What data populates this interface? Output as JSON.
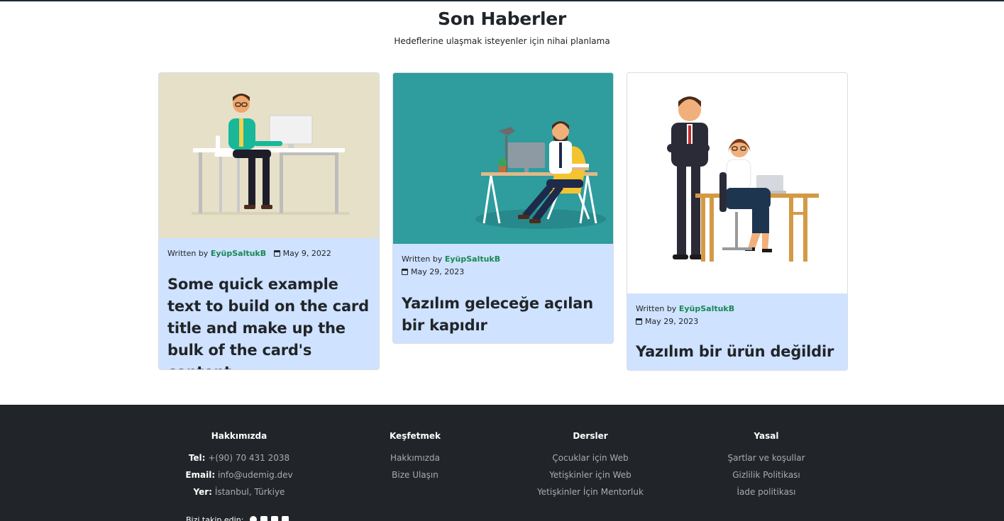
{
  "section": {
    "title": "Son Haberler",
    "subtitle": "Hedeflerine ulaşmak isteyenler için nihai planlama"
  },
  "cards": [
    {
      "written_by": "Written by",
      "author": "EyüpSaltukB",
      "date": "May 9, 2022",
      "title": "Some quick example text to build on the card title and make up the bulk of the card's content."
    },
    {
      "written_by": "Written by",
      "author": "EyüpSaltukB",
      "date": "May 29, 2023",
      "title": "Yazılım geleceğe açılan bir kapıdır"
    },
    {
      "written_by": "Written by",
      "author": "EyüpSaltukB",
      "date": "May 29, 2023",
      "title": "Yazılım bir ürün değildir"
    }
  ],
  "footer": {
    "about": {
      "heading": "Hakkımızda",
      "phone_label": "Tel:",
      "phone": "+(90) 70 431 2038",
      "email_label": "Email:",
      "email": "info@udemig.dev",
      "location_label": "Yer:",
      "location": "İstanbul, Türkiye"
    },
    "explore": {
      "heading": "Keşfetmek",
      "links": [
        "Hakkımızda",
        "Bize Ulaşın"
      ]
    },
    "courses": {
      "heading": "Dersler",
      "links": [
        "Çocuklar için Web",
        "Yetişkinler için Web",
        "Yetişkinler İçin Mentorluk"
      ]
    },
    "legal": {
      "heading": "Yasal",
      "links": [
        "Şartlar ve koşullar",
        "Gizlilik Politikası",
        "İade politikası"
      ]
    },
    "follow": "Bizi takip edin:",
    "social_icons": [
      "facebook-icon",
      "twitter-icon",
      "instagram-icon",
      "linkedin-icon"
    ]
  }
}
